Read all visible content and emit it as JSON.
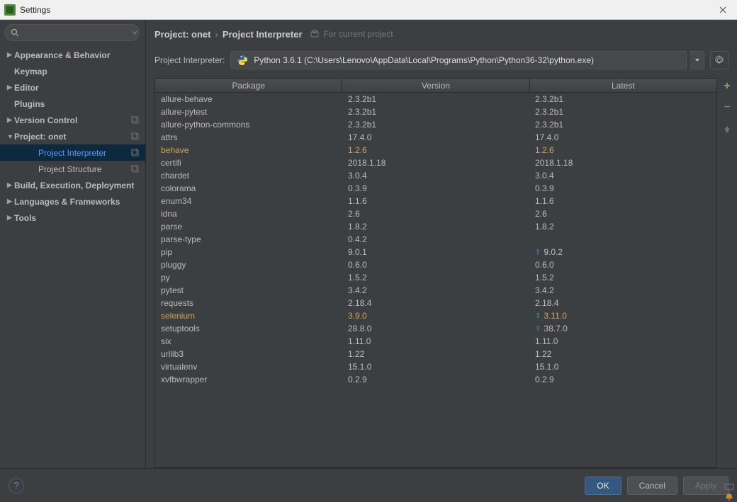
{
  "window": {
    "title": "Settings"
  },
  "search": {
    "placeholder": ""
  },
  "sidebar": {
    "items": [
      {
        "label": "Appearance & Behavior",
        "arrow": "▶",
        "bold": true
      },
      {
        "label": "Keymap",
        "arrow": "",
        "bold": true
      },
      {
        "label": "Editor",
        "arrow": "▶",
        "bold": true
      },
      {
        "label": "Plugins",
        "arrow": "",
        "bold": true
      },
      {
        "label": "Version Control",
        "arrow": "▶",
        "bold": true,
        "rightIcon": true
      },
      {
        "label": "Project: onet",
        "arrow": "▼",
        "bold": true,
        "rightIcon": true
      },
      {
        "label": "Project Interpreter",
        "arrow": "",
        "indent": 2,
        "selected": true,
        "rightIcon": true
      },
      {
        "label": "Project Structure",
        "arrow": "",
        "indent": 2,
        "rightIcon": true
      },
      {
        "label": "Build, Execution, Deployment",
        "arrow": "▶",
        "bold": true
      },
      {
        "label": "Languages & Frameworks",
        "arrow": "▶",
        "bold": true
      },
      {
        "label": "Tools",
        "arrow": "▶",
        "bold": true
      }
    ]
  },
  "breadcrumb": {
    "part1": "Project: onet",
    "sep": "›",
    "part2": "Project Interpreter",
    "forCurrent": "For current project"
  },
  "interpreter": {
    "label": "Project Interpreter:",
    "value": "Python 3.6.1 (C:\\Users\\Lenovo\\AppData\\Local\\Programs\\Python\\Python36-32\\python.exe)"
  },
  "table": {
    "headers": [
      "Package",
      "Version",
      "Latest"
    ],
    "rows": [
      {
        "pkg": "allure-behave",
        "ver": "2.3.2b1",
        "lat": "2.3.2b1"
      },
      {
        "pkg": "allure-pytest",
        "ver": "2.3.2b1",
        "lat": "2.3.2b1"
      },
      {
        "pkg": "allure-python-commons",
        "ver": "2.3.2b1",
        "lat": "2.3.2b1"
      },
      {
        "pkg": "attrs",
        "ver": "17.4.0",
        "lat": "17.4.0"
      },
      {
        "pkg": "behave",
        "ver": "1.2.6",
        "lat": "1.2.6",
        "hl": true
      },
      {
        "pkg": "certifi",
        "ver": "2018.1.18",
        "lat": "2018.1.18"
      },
      {
        "pkg": "chardet",
        "ver": "3.0.4",
        "lat": "3.0.4"
      },
      {
        "pkg": "colorama",
        "ver": "0.3.9",
        "lat": "0.3.9"
      },
      {
        "pkg": "enum34",
        "ver": "1.1.6",
        "lat": "1.1.6"
      },
      {
        "pkg": "idna",
        "ver": "2.6",
        "lat": "2.6"
      },
      {
        "pkg": "parse",
        "ver": "1.8.2",
        "lat": "1.8.2"
      },
      {
        "pkg": "parse-type",
        "ver": "0.4.2",
        "lat": ""
      },
      {
        "pkg": "pip",
        "ver": "9.0.1",
        "lat": "9.0.2",
        "upgrade": "blue"
      },
      {
        "pkg": "pluggy",
        "ver": "0.6.0",
        "lat": "0.6.0"
      },
      {
        "pkg": "py",
        "ver": "1.5.2",
        "lat": "1.5.2"
      },
      {
        "pkg": "pytest",
        "ver": "3.4.2",
        "lat": "3.4.2"
      },
      {
        "pkg": "requests",
        "ver": "2.18.4",
        "lat": "2.18.4"
      },
      {
        "pkg": "selenium",
        "ver": "3.9.0",
        "lat": "3.11.0",
        "hl": true,
        "upgrade": "green"
      },
      {
        "pkg": "setuptools",
        "ver": "28.8.0",
        "lat": "38.7.0",
        "upgrade": "blue"
      },
      {
        "pkg": "six",
        "ver": "1.11.0",
        "lat": "1.11.0"
      },
      {
        "pkg": "urllib3",
        "ver": "1.22",
        "lat": "1.22"
      },
      {
        "pkg": "virtualenv",
        "ver": "15.1.0",
        "lat": "15.1.0"
      },
      {
        "pkg": "xvfbwrapper",
        "ver": "0.2.9",
        "lat": "0.2.9"
      }
    ]
  },
  "buttons": {
    "ok": "OK",
    "cancel": "Cancel",
    "apply": "Apply"
  }
}
